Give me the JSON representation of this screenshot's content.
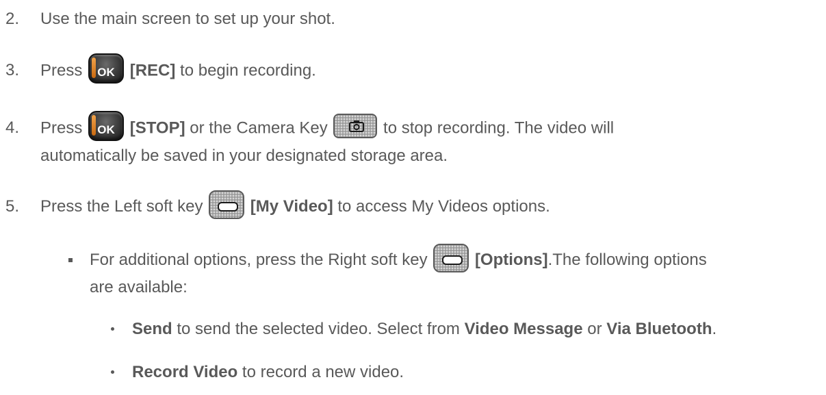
{
  "steps": {
    "s2": {
      "number": "2.",
      "text": "Use the main screen to set up your shot."
    },
    "s3": {
      "number": "3.",
      "pre": "Press",
      "key_label": "OK",
      "bold": "[REC]",
      "post": "to begin recording."
    },
    "s4": {
      "number": "4.",
      "pre": "Press",
      "key_label": "OK",
      "bold": "[STOP]",
      "mid": "or the Camera Key",
      "post": "to stop recording. The video will",
      "cont": "automatically be saved in your designated storage area."
    },
    "s5": {
      "number": "5.",
      "pre": "Press the Left soft key",
      "bold": "[My Video]",
      "post": "to access My Videos options."
    }
  },
  "sub": {
    "pre": "For additional options, press the Right soft key",
    "bold": "[Options]",
    "post": ".The following options",
    "cont": "are available:"
  },
  "options": [
    {
      "b1": "Send",
      "t1": " to send the selected video. Select from ",
      "b2": "Video Message",
      "t2": " or ",
      "b3": "Via Bluetooth",
      "t3": "."
    },
    {
      "b1": "Record Video",
      "t1": " to record a new video."
    }
  ],
  "icons": {
    "ok_key": "ok-key-icon",
    "camera_key": "camera-key-icon",
    "soft_key": "soft-key-icon"
  },
  "colors": {
    "text": "#595959",
    "ok_key_accent": "#e08a2c"
  }
}
